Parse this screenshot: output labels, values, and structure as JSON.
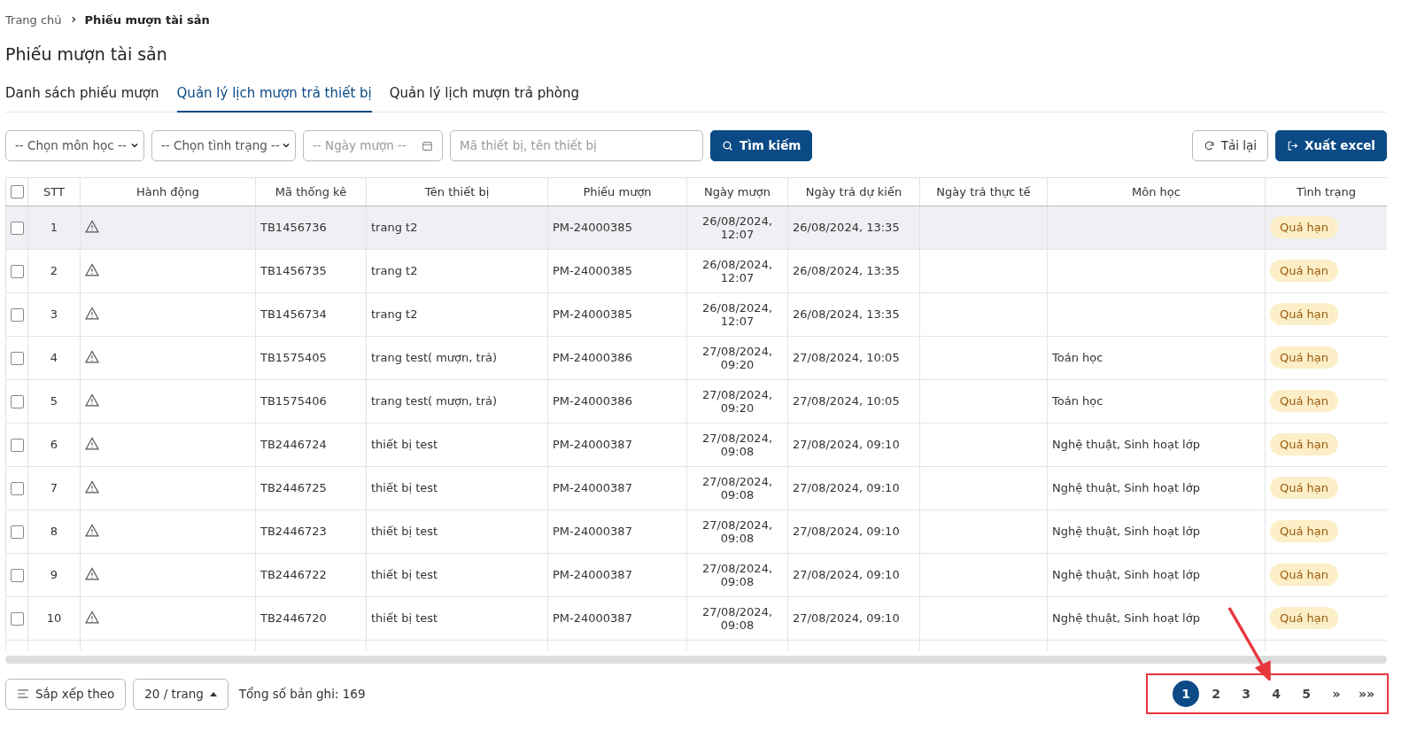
{
  "breadcrumb": [
    {
      "label": "Trang chủ",
      "current": false
    },
    {
      "label": "Phiếu mượn tài sản",
      "current": true
    }
  ],
  "title": "Phiếu mượn tài sản",
  "tabs": [
    {
      "label": "Danh sách phiếu mượn",
      "selected": false
    },
    {
      "label": "Quản lý lịch mượn trả thiết bị",
      "selected": true
    },
    {
      "label": "Quản lý lịch mượn trả phòng",
      "selected": false
    }
  ],
  "filters": {
    "subject_select": "-- Chọn môn học --",
    "status_select": "-- Chọn tình trạng --",
    "date_placeholder": "-- Ngày mượn --",
    "search_placeholder": "Mã thiết bị, tên thiết bị",
    "search_button": "Tìm kiếm",
    "reload_button": "Tải lại",
    "export_button": "Xuất excel"
  },
  "table": {
    "all_checked": false,
    "columns": [
      "STT",
      "Hành động",
      "Mã thống kê",
      "Tên thiết bị",
      "Phiếu mượn",
      "Ngày mượn",
      "Ngày trả dự kiến",
      "Ngày trả thực tế",
      "Môn học",
      "Tình trạng"
    ],
    "rows": [
      {
        "checked": false,
        "highlighted": true,
        "stt": "1",
        "code": "TB1456736",
        "name": "trang t2",
        "slip": "PM-24000385",
        "borrow_date": "26/08/2024,",
        "borrow_time": "12:07",
        "due": "26/08/2024, 13:35",
        "returned": "",
        "subject": "",
        "status": "Quá hạn"
      },
      {
        "checked": false,
        "highlighted": false,
        "stt": "2",
        "code": "TB1456735",
        "name": "trang t2",
        "slip": "PM-24000385",
        "borrow_date": "26/08/2024,",
        "borrow_time": "12:07",
        "due": "26/08/2024, 13:35",
        "returned": "",
        "subject": "",
        "status": "Quá hạn"
      },
      {
        "checked": false,
        "highlighted": false,
        "stt": "3",
        "code": "TB1456734",
        "name": "trang t2",
        "slip": "PM-24000385",
        "borrow_date": "26/08/2024,",
        "borrow_time": "12:07",
        "due": "26/08/2024, 13:35",
        "returned": "",
        "subject": "",
        "status": "Quá hạn"
      },
      {
        "checked": false,
        "highlighted": false,
        "stt": "4",
        "code": "TB1575405",
        "name": "trang test( mượn, trả)",
        "slip": "PM-24000386",
        "borrow_date": "27/08/2024,",
        "borrow_time": "09:20",
        "due": "27/08/2024, 10:05",
        "returned": "",
        "subject": "Toán học",
        "status": "Quá hạn"
      },
      {
        "checked": false,
        "highlighted": false,
        "stt": "5",
        "code": "TB1575406",
        "name": "trang test( mượn, trả)",
        "slip": "PM-24000386",
        "borrow_date": "27/08/2024,",
        "borrow_time": "09:20",
        "due": "27/08/2024, 10:05",
        "returned": "",
        "subject": "Toán học",
        "status": "Quá hạn"
      },
      {
        "checked": false,
        "highlighted": false,
        "stt": "6",
        "code": "TB2446724",
        "name": "thiết bị test",
        "slip": "PM-24000387",
        "borrow_date": "27/08/2024,",
        "borrow_time": "09:08",
        "due": "27/08/2024, 09:10",
        "returned": "",
        "subject": "Nghệ thuật, Sinh hoạt lớp",
        "status": "Quá hạn"
      },
      {
        "checked": false,
        "highlighted": false,
        "stt": "7",
        "code": "TB2446725",
        "name": "thiết bị test",
        "slip": "PM-24000387",
        "borrow_date": "27/08/2024,",
        "borrow_time": "09:08",
        "due": "27/08/2024, 09:10",
        "returned": "",
        "subject": "Nghệ thuật, Sinh hoạt lớp",
        "status": "Quá hạn"
      },
      {
        "checked": false,
        "highlighted": false,
        "stt": "8",
        "code": "TB2446723",
        "name": "thiết bị test",
        "slip": "PM-24000387",
        "borrow_date": "27/08/2024,",
        "borrow_time": "09:08",
        "due": "27/08/2024, 09:10",
        "returned": "",
        "subject": "Nghệ thuật, Sinh hoạt lớp",
        "status": "Quá hạn"
      },
      {
        "checked": false,
        "highlighted": false,
        "stt": "9",
        "code": "TB2446722",
        "name": "thiết bị test",
        "slip": "PM-24000387",
        "borrow_date": "27/08/2024,",
        "borrow_time": "09:08",
        "due": "27/08/2024, 09:10",
        "returned": "",
        "subject": "Nghệ thuật, Sinh hoạt lớp",
        "status": "Quá hạn"
      },
      {
        "checked": false,
        "highlighted": false,
        "stt": "10",
        "code": "TB2446720",
        "name": "thiết bị test",
        "slip": "PM-24000387",
        "borrow_date": "27/08/2024,",
        "borrow_time": "09:08",
        "due": "27/08/2024, 09:10",
        "returned": "",
        "subject": "Nghệ thuật, Sinh hoạt lớp",
        "status": "Quá hạn"
      }
    ]
  },
  "footer": {
    "sort_button": "Sắp xếp theo",
    "page_size": "20 / trang",
    "total": "Tổng số bản ghi: 169"
  },
  "pagination": {
    "pages": [
      {
        "label": "1",
        "selected": true
      },
      {
        "label": "2",
        "selected": false
      },
      {
        "label": "3",
        "selected": false
      },
      {
        "label": "4",
        "selected": false
      },
      {
        "label": "5",
        "selected": false
      }
    ],
    "next": "»",
    "last": "»»"
  }
}
